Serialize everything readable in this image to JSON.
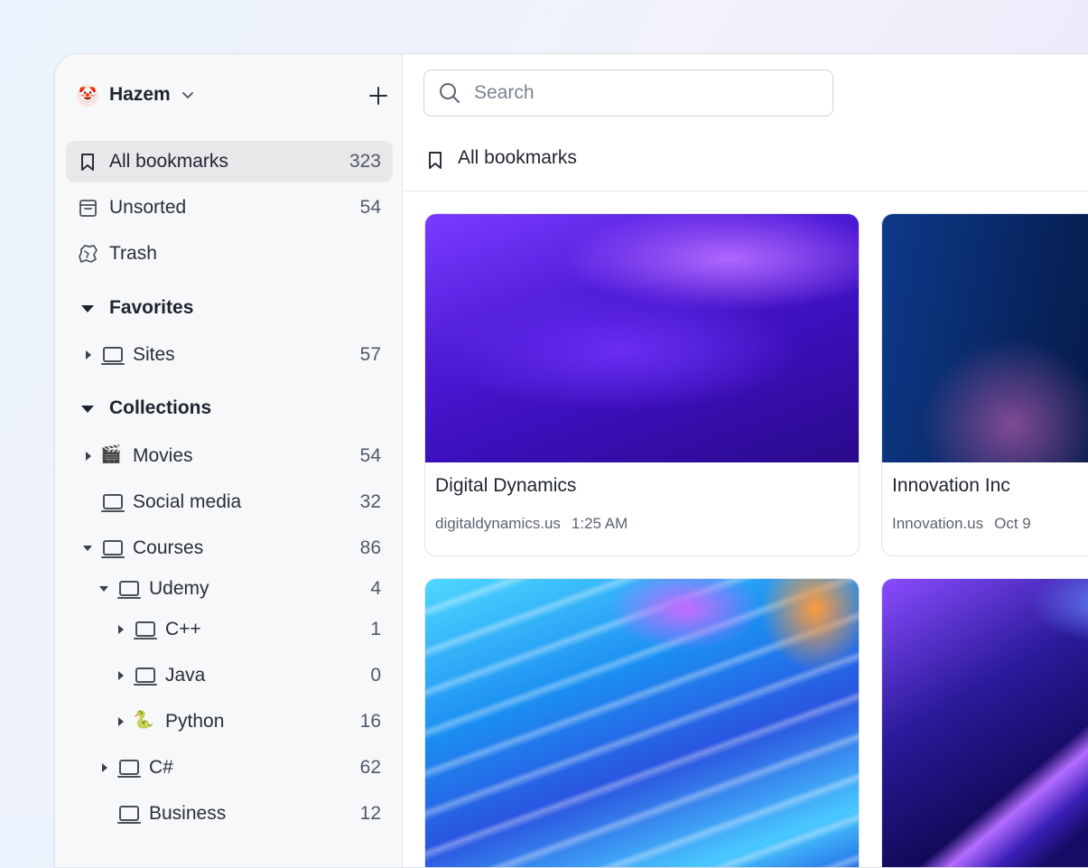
{
  "workspace": {
    "user_name": "Hazem",
    "add_label": "+"
  },
  "sidebar": {
    "nav": [
      {
        "label": "All bookmarks",
        "count": "323"
      },
      {
        "label": "Unsorted",
        "count": "54"
      },
      {
        "label": "Trash",
        "count": ""
      }
    ],
    "favorites": {
      "title": "Favorites",
      "items": [
        {
          "label": "Sites",
          "count": "57"
        }
      ]
    },
    "collections": {
      "title": "Collections",
      "items": [
        {
          "label": "Movies",
          "count": "54"
        },
        {
          "label": "Social media",
          "count": "32"
        },
        {
          "label": "Courses",
          "count": "86"
        },
        {
          "label": "Udemy",
          "count": "4"
        },
        {
          "label": "C++",
          "count": "1"
        },
        {
          "label": "Java",
          "count": "0"
        },
        {
          "label": "Python",
          "count": "16"
        },
        {
          "label": "C#",
          "count": "62"
        },
        {
          "label": "Business",
          "count": "12"
        }
      ]
    }
  },
  "search": {
    "placeholder": "Search"
  },
  "main": {
    "heading": "All bookmarks",
    "cards": [
      {
        "title": "Digital Dynamics",
        "domain": "digitaldynamics.us",
        "time": "1:25 AM"
      },
      {
        "title": "Innovation Inc",
        "domain": "Innovation.us",
        "time": "Oct 9"
      },
      {
        "title": "",
        "domain": "",
        "time": ""
      },
      {
        "title": "",
        "domain": "",
        "time": ""
      }
    ]
  }
}
